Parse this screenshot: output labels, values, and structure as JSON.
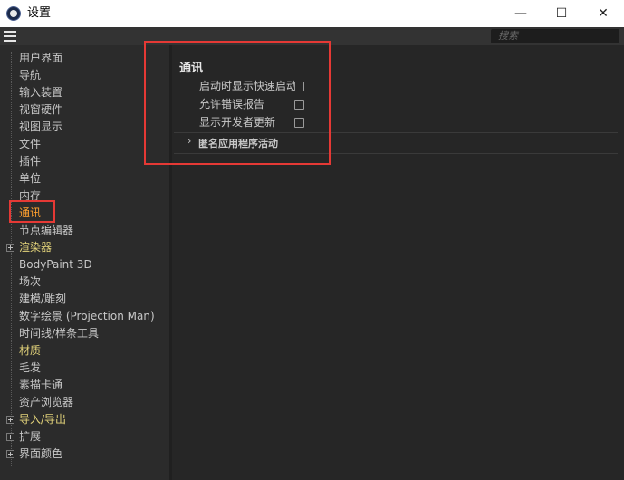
{
  "window": {
    "title": "设置",
    "minimize": "—",
    "maximize": "☐",
    "close": "✕"
  },
  "search": {
    "placeholder": "搜索"
  },
  "sidebar": {
    "items": [
      {
        "label": "用户界面",
        "state": "normal"
      },
      {
        "label": "导航",
        "state": "normal"
      },
      {
        "label": "输入装置",
        "state": "normal"
      },
      {
        "label": "视窗硬件",
        "state": "normal"
      },
      {
        "label": "视图显示",
        "state": "normal"
      },
      {
        "label": "文件",
        "state": "normal"
      },
      {
        "label": "插件",
        "state": "normal"
      },
      {
        "label": "单位",
        "state": "normal"
      },
      {
        "label": "内存",
        "state": "normal"
      },
      {
        "label": "通讯",
        "state": "selected"
      },
      {
        "label": "节点编辑器",
        "state": "normal"
      },
      {
        "label": "渲染器",
        "state": "expandable"
      },
      {
        "label": "BodyPaint 3D",
        "state": "normal"
      },
      {
        "label": "场次",
        "state": "normal"
      },
      {
        "label": "建模/雕刻",
        "state": "normal"
      },
      {
        "label": "数字绘景 (Projection Man)",
        "state": "normal"
      },
      {
        "label": "时间线/样条工具",
        "state": "normal"
      },
      {
        "label": "材质",
        "state": "highlight"
      },
      {
        "label": "毛发",
        "state": "normal"
      },
      {
        "label": "素描卡通",
        "state": "normal"
      },
      {
        "label": "资产浏览器",
        "state": "normal"
      },
      {
        "label": "导入/导出",
        "state": "expandable"
      },
      {
        "label": "扩展",
        "state": "expandable"
      },
      {
        "label": "界面颜色",
        "state": "expandable"
      }
    ]
  },
  "panel": {
    "title": "通讯",
    "options": [
      {
        "label": "启动时显示快速启动",
        "checked": false
      },
      {
        "label": "允许错误报告",
        "checked": false
      },
      {
        "label": "显示开发者更新",
        "checked": false
      }
    ],
    "collapsed_group": "匿名应用程序活动"
  },
  "colors": {
    "selected": "#ffa02e",
    "highlight": "#e3d37a",
    "annotation": "#e53935"
  }
}
